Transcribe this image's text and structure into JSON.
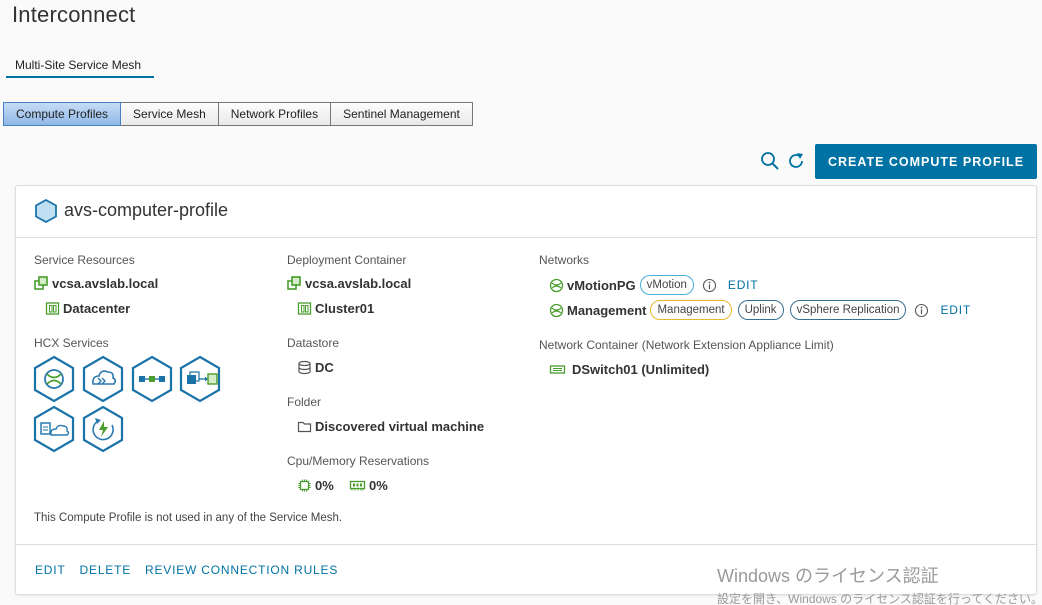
{
  "page": {
    "title": "Interconnect"
  },
  "subnav": {
    "label": "Multi-Site Service Mesh"
  },
  "tabs": [
    {
      "label": "Compute Profiles",
      "active": true
    },
    {
      "label": "Service Mesh",
      "active": false
    },
    {
      "label": "Network Profiles",
      "active": false
    },
    {
      "label": "Sentinel Management",
      "active": false
    }
  ],
  "toolbar": {
    "search_icon": "search-icon",
    "refresh_icon": "refresh-icon",
    "create_label": "CREATE COMPUTE PROFILE"
  },
  "profile": {
    "name": "avs-computer-profile",
    "service_resources": {
      "label": "Service Resources",
      "vcenter": "vcsa.avslab.local",
      "datacenter": "Datacenter"
    },
    "hcx_services": {
      "label": "HCX Services"
    },
    "deployment_container": {
      "label": "Deployment Container",
      "vcenter": "vcsa.avslab.local",
      "cluster": "Cluster01"
    },
    "datastore": {
      "label": "Datastore",
      "value": "DC"
    },
    "folder": {
      "label": "Folder",
      "value": "Discovered virtual machine"
    },
    "reservations": {
      "label": "Cpu/Memory Reservations",
      "cpu": "0%",
      "memory": "0%"
    },
    "networks": {
      "label": "Networks",
      "items": [
        {
          "name": "vMotionPG",
          "badges": [
            "vMotion"
          ],
          "edit": "EDIT"
        },
        {
          "name": "Management",
          "badges": [
            "Management",
            "Uplink",
            "vSphere Replication"
          ],
          "edit": "EDIT"
        }
      ]
    },
    "network_container": {
      "label": "Network Container (Network Extension Appliance Limit)",
      "value": "DSwitch01 (Unlimited)"
    },
    "note": "This Compute Profile is not used in any of the Service Mesh.",
    "actions": {
      "edit": "EDIT",
      "delete": "DELETE",
      "review": "REVIEW CONNECTION RULES"
    }
  },
  "watermark": {
    "line1": "Windows のライセンス認証",
    "line2": "設定を開き、Windows のライセンス認証を行ってください。"
  },
  "colors": {
    "accent": "#0072a3",
    "green": "#4a9c2d",
    "hex_blue": "#1a73a8"
  }
}
